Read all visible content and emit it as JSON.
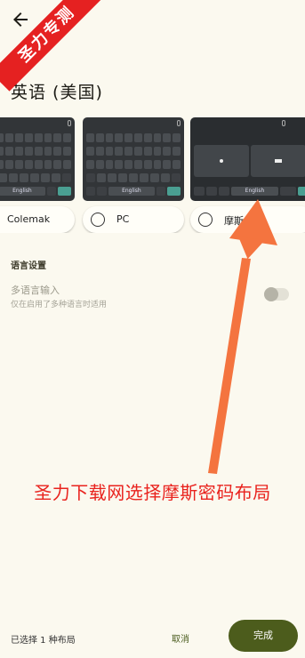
{
  "watermark": {
    "text": "圣力专测"
  },
  "header": {
    "title": "英语 (美国)"
  },
  "layouts": [
    {
      "label": "Colemak",
      "space_label": "English"
    },
    {
      "label": "PC",
      "space_label": "English"
    },
    {
      "label": "摩斯",
      "space_label": "English"
    }
  ],
  "settings": {
    "section_title": "语言设置",
    "multilang": {
      "title": "多语言输入",
      "subtitle": "仅在启用了多种语言时适用"
    }
  },
  "annotation": {
    "text": "圣力下载网选择摩斯密码布局"
  },
  "footer": {
    "selected_text": "已选择 1 种布局",
    "cancel_label": "取消",
    "done_label": "完成"
  },
  "colors": {
    "accent": "#4c5c1c",
    "annotation": "#e9231e",
    "arrow": "#f4743f"
  }
}
